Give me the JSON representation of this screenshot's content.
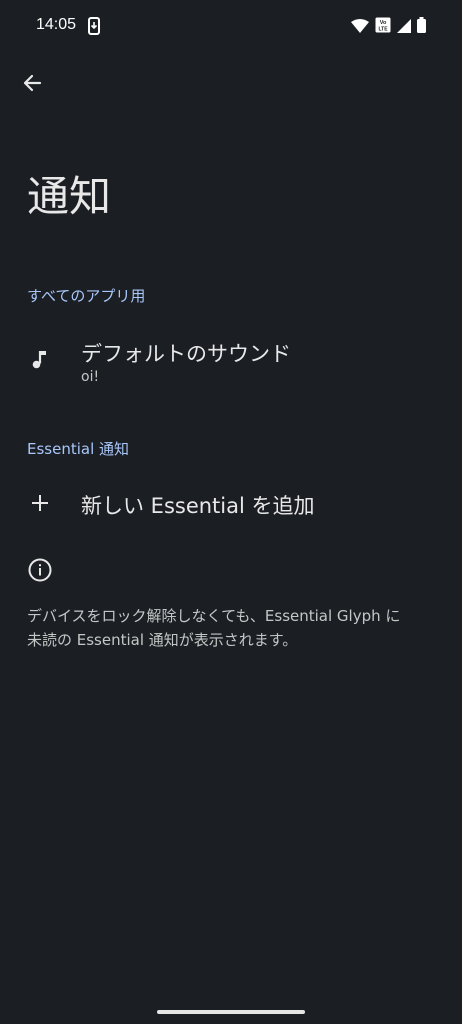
{
  "status_bar": {
    "time": "14:05",
    "network_badge_top": "Vo",
    "network_badge_bottom": "LTE"
  },
  "header": {
    "back_icon": "arrow-left-icon",
    "title": "通知"
  },
  "sections": {
    "all_apps": {
      "header": "すべてのアプリ用",
      "default_sound": {
        "icon": "music-note-icon",
        "title": "デフォルトのサウンド",
        "summary": "oi!"
      }
    },
    "essential": {
      "header": "Essential 通知",
      "add": {
        "icon": "plus-icon",
        "title": "新しい Essential を追加"
      }
    }
  },
  "info": {
    "icon": "info-icon",
    "line1": "デバイスをロック解除しなくても、Essential Glyph に",
    "line2": "未読の Essential 通知が表示されます。"
  },
  "colors": {
    "background": "#1b1e23",
    "accent": "#a8c7fa",
    "text_primary": "#e8e8e8",
    "text_secondary": "#c4c7c5"
  }
}
